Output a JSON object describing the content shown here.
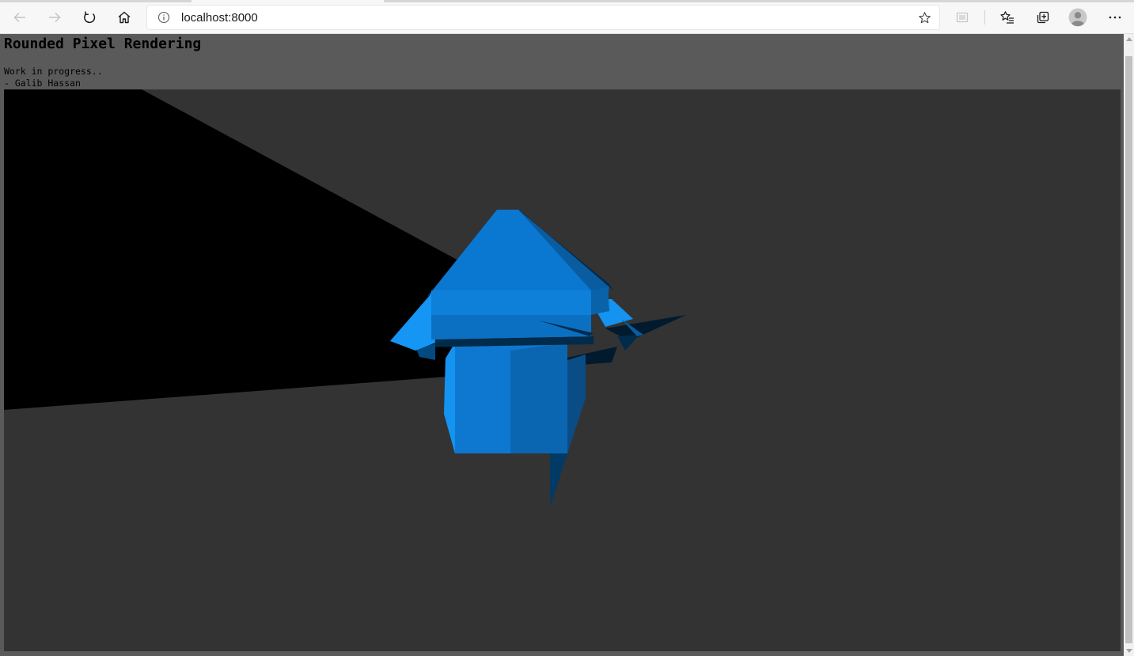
{
  "browser": {
    "url": "localhost:8000",
    "toolbar_icons": [
      "back-icon",
      "forward-icon",
      "refresh-icon",
      "home-icon",
      "site-info-icon",
      "favorite-star-icon",
      "extension-icon",
      "favorites-list-icon",
      "collections-icon",
      "profile-avatar-icon",
      "more-menu-icon"
    ]
  },
  "page": {
    "title": "Rounded Pixel Rendering",
    "status_text": "Work in progress..",
    "author_text": "- Galib Hassan"
  },
  "render": {
    "background_color": "#333333",
    "shadow_color": "#000000",
    "object_color": "#0f84e0",
    "object_dark_color": "#0a5ca0",
    "object_shadow_color": "#012b4a"
  }
}
